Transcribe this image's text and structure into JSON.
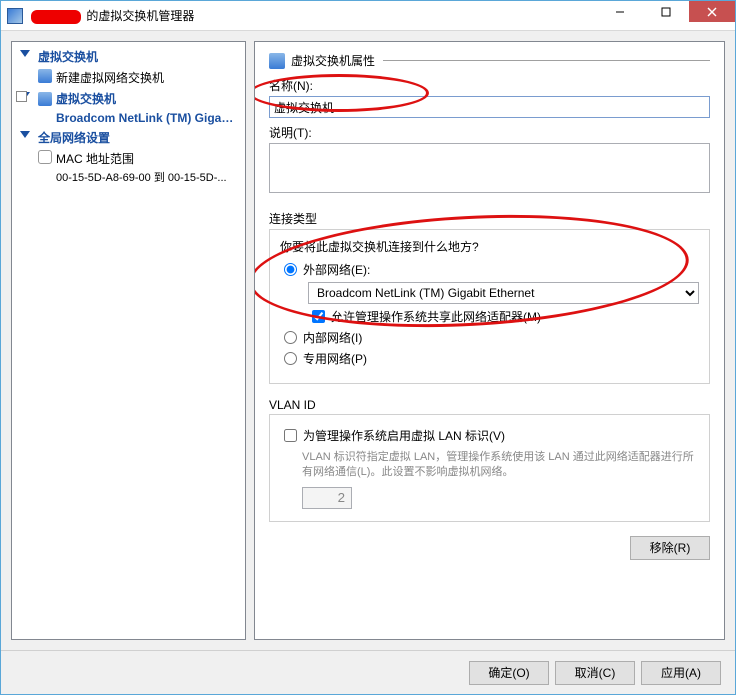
{
  "window_title_suffix": " 的虚拟交换机管理器",
  "tree": {
    "section1": "虚拟交换机",
    "new_switch": "新建虚拟网络交换机",
    "section2": "虚拟交换机",
    "selected_switch": "Broadcom NetLink (TM) Gigabi...",
    "section3": "全局网络设置",
    "mac_range": "MAC 地址范围",
    "mac_range_sub": "00-15-5D-A8-69-00 到 00-15-5D-..."
  },
  "detail": {
    "header": "虚拟交换机属性",
    "name_label": "名称(N):",
    "name_value": "虚拟交换机",
    "desc_label": "说明(T):",
    "desc_value": "",
    "conn_group": "连接类型",
    "conn_prompt": "你要将此虚拟交换机连接到什么地方?",
    "ext_label": "外部网络(E):",
    "adapter": "Broadcom NetLink (TM) Gigabit Ethernet",
    "allow_mgmt": "允许管理操作系统共享此网络适配器(M)",
    "int_label": "内部网络(I)",
    "priv_label": "专用网络(P)",
    "vlan_group": "VLAN ID",
    "vlan_enable": "为管理操作系统启用虚拟 LAN 标识(V)",
    "vlan_help": "VLAN 标识符指定虚拟 LAN，管理操作系统使用该 LAN 通过此网络适配器进行所有网络通信(L)。此设置不影响虚拟机网络。",
    "vlan_value": "2",
    "remove": "移除(R)"
  },
  "buttons": {
    "ok": "确定(O)",
    "cancel": "取消(C)",
    "apply": "应用(A)"
  }
}
